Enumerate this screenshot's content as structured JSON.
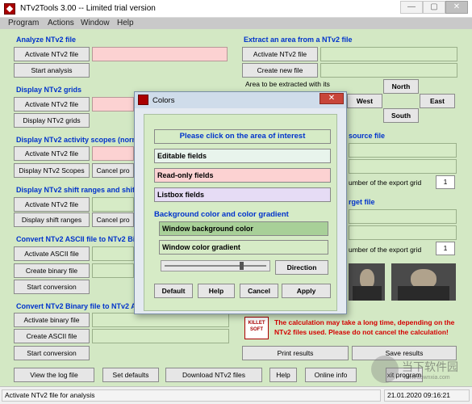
{
  "window": {
    "title": "NTv2Tools 3.00 -- Limited trial version",
    "minimize_glyph": "—",
    "maximize_glyph": "▢",
    "close_glyph": "✕"
  },
  "menu": [
    "Program",
    "Actions",
    "Window",
    "Help"
  ],
  "analyze": {
    "title": "Analyze NTv2 file",
    "activate_button": "Activate NTv2 file",
    "start_button": "Start analysis"
  },
  "display_grids": {
    "title": "Display NTv2 grids",
    "activate_button": "Activate NTv2 file",
    "display_button": "Display NTv2 grids"
  },
  "activity_scopes": {
    "title": "Display NTv2 activity scopes (norm",
    "activate_button": "Activate NTv2 file",
    "display_button": "Display NTv2 Scopes",
    "cancel_button": "Cancel pro"
  },
  "shift_ranges": {
    "title": "Display NTv2 shift ranges and shift",
    "activate_button": "Activate NTv2 file",
    "display_button": "Display shift ranges",
    "cancel_button": "Cancel pro"
  },
  "ascii_to_binary": {
    "title": "Convert NTv2 ASCII file to NTv2 Bin",
    "activate_button": "Activate ASCII file",
    "create_button": "Create binary file",
    "start_button": "Start conversion"
  },
  "binary_to_ascii": {
    "title": "Convert NTv2 Binary file to NTv2 AS",
    "activate_button": "Activate binary file",
    "create_button": "Create ASCII file",
    "start_button": "Start conversion"
  },
  "extract": {
    "title": "Extract an area from a NTv2 file",
    "activate_button": "Activate NTv2 file",
    "create_button": "Create new file",
    "area_label": "Area to be extracted with its",
    "north_button": "North",
    "west_button": "West",
    "east_button": "East",
    "south_button": "South",
    "source_title": "source file",
    "target_title": "rget file",
    "export_grid_label": "umber of the export grid",
    "export_grid_value_1": "1",
    "export_grid_value_2": "1"
  },
  "warning": {
    "logo_text": "KILLET SOFT",
    "text_line1": "The calculation may take a long time, depending on the",
    "text_line2": "NTv2 files used. Please do not cancel the calculation!",
    "print_button": "Print results",
    "save_button": "Save results"
  },
  "bottom_buttons": {
    "view_log": "View the log file",
    "set_defaults": "Set defaults",
    "download": "Download NTv2 files",
    "help": "Help",
    "online_info": "Online info",
    "exit": "xit program"
  },
  "status": {
    "message": "Activate NTv2 file for analysis",
    "datetime": "21.01.2020  09:16:21"
  },
  "colors_dialog": {
    "title": "Colors",
    "close_glyph": "✕",
    "instruction": "Please click on the area of interest",
    "editable_fields": "Editable fields",
    "readonly_fields": "Read-only fields",
    "listbox_fields": "Listbox fields",
    "bg_section_title": "Background color and color gradient",
    "window_background": "Window background color",
    "window_gradient": "Window color gradient",
    "direction_button": "Direction",
    "default_button": "Default",
    "help_button": "Help",
    "cancel_button": "Cancel",
    "apply_button": "Apply",
    "slider_value": 0.75
  },
  "watermark": {
    "text": "当下软件园",
    "sub": "www.downxia.com"
  },
  "colors": {
    "client_bg": "#d3e8c4",
    "readonly_field": "#fcd2d2",
    "section_title": "#0033cc",
    "warning_text": "#d40000",
    "listbox_field": "#e6dcf5",
    "editable_field": "#e8f4ec"
  }
}
